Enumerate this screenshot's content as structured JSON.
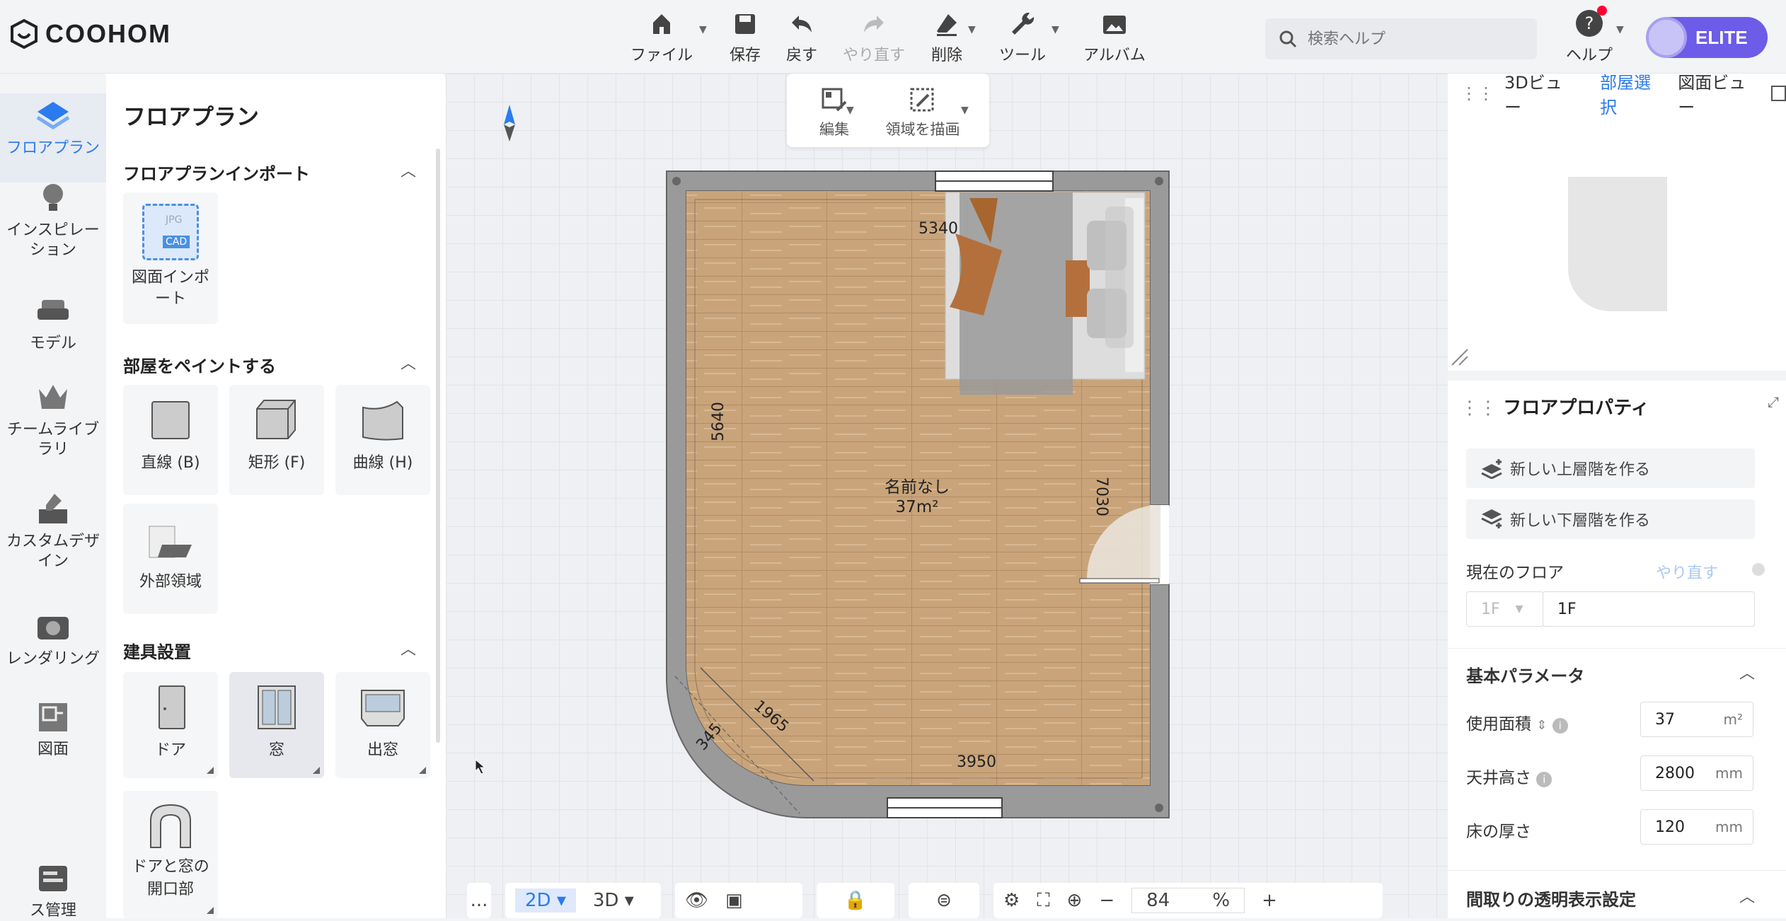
{
  "app": {
    "logo": "COOHOM"
  },
  "toolbar": {
    "file": "ファイル",
    "save": "保存",
    "undo": "戻す",
    "redo": "やり直す",
    "delete": "削除",
    "tools": "ツール",
    "album": "アルバム"
  },
  "search": {
    "placeholder": "検索ヘルプ"
  },
  "help": {
    "label": "ヘルプ",
    "glyph": "?"
  },
  "account": {
    "badge": "ELITE"
  },
  "leftnav": {
    "floorplan": "フロアプラン",
    "inspiration": "インスピレーション",
    "model": "モデル",
    "team": "チームライブラリ",
    "custom": "カスタムデザイン",
    "render": "レンダリング",
    "drawing": "図面",
    "more": "ス管理"
  },
  "panel": {
    "title": "フロアプラン",
    "import_section": "フロアプランインポート",
    "import_card": "図面インポート",
    "import_tags": [
      "JPG",
      "CAD"
    ],
    "paint_section": "部屋をペイントする",
    "paint_items": [
      "直線 (B)",
      "矩形 (F)",
      "曲線 (H)",
      "外部領域"
    ],
    "fixtures_section": "建具設置",
    "fixture_items": [
      "ドア",
      "窓",
      "出窓",
      "ドアと窓の開口部"
    ]
  },
  "editbar": {
    "edit": "編集",
    "draw_area": "領域を描画"
  },
  "plan": {
    "room_name": "名前なし",
    "room_area": "37m²",
    "dims": [
      "5340",
      "5640",
      "7030",
      "3950",
      "1965",
      "345"
    ]
  },
  "bottombar": {
    "more": "...",
    "mode2d": "2D",
    "mode3d": "3D",
    "zoom": "84",
    "zoom_unit": "%"
  },
  "rightpanel": {
    "tabs": [
      "3Dビュー",
      "部屋選択",
      "図面ビュー"
    ],
    "props_title": "フロアプロパティ",
    "new_upper": "新しい上層階を作る",
    "new_lower": "新しい下層階を作る",
    "current_floor": "現在のフロア",
    "redo_link": "やり直す",
    "floor_select": "1F",
    "floor_name": "1F",
    "basic_params": "基本パラメータ",
    "area_label": "使用面積",
    "area_value": "37",
    "area_unit": "m²",
    "ceiling_label": "天井高さ",
    "ceiling_value": "2800",
    "ceiling_unit": "mm",
    "floor_thickness_label": "床の厚さ",
    "floor_thickness_value": "120",
    "floor_thickness_unit": "mm",
    "transparency_label": "間取りの透明表示設定"
  },
  "colors": {
    "accent": "#2b7bf0",
    "elite": "#6c5ce7",
    "wall": "#9a9a9a"
  }
}
